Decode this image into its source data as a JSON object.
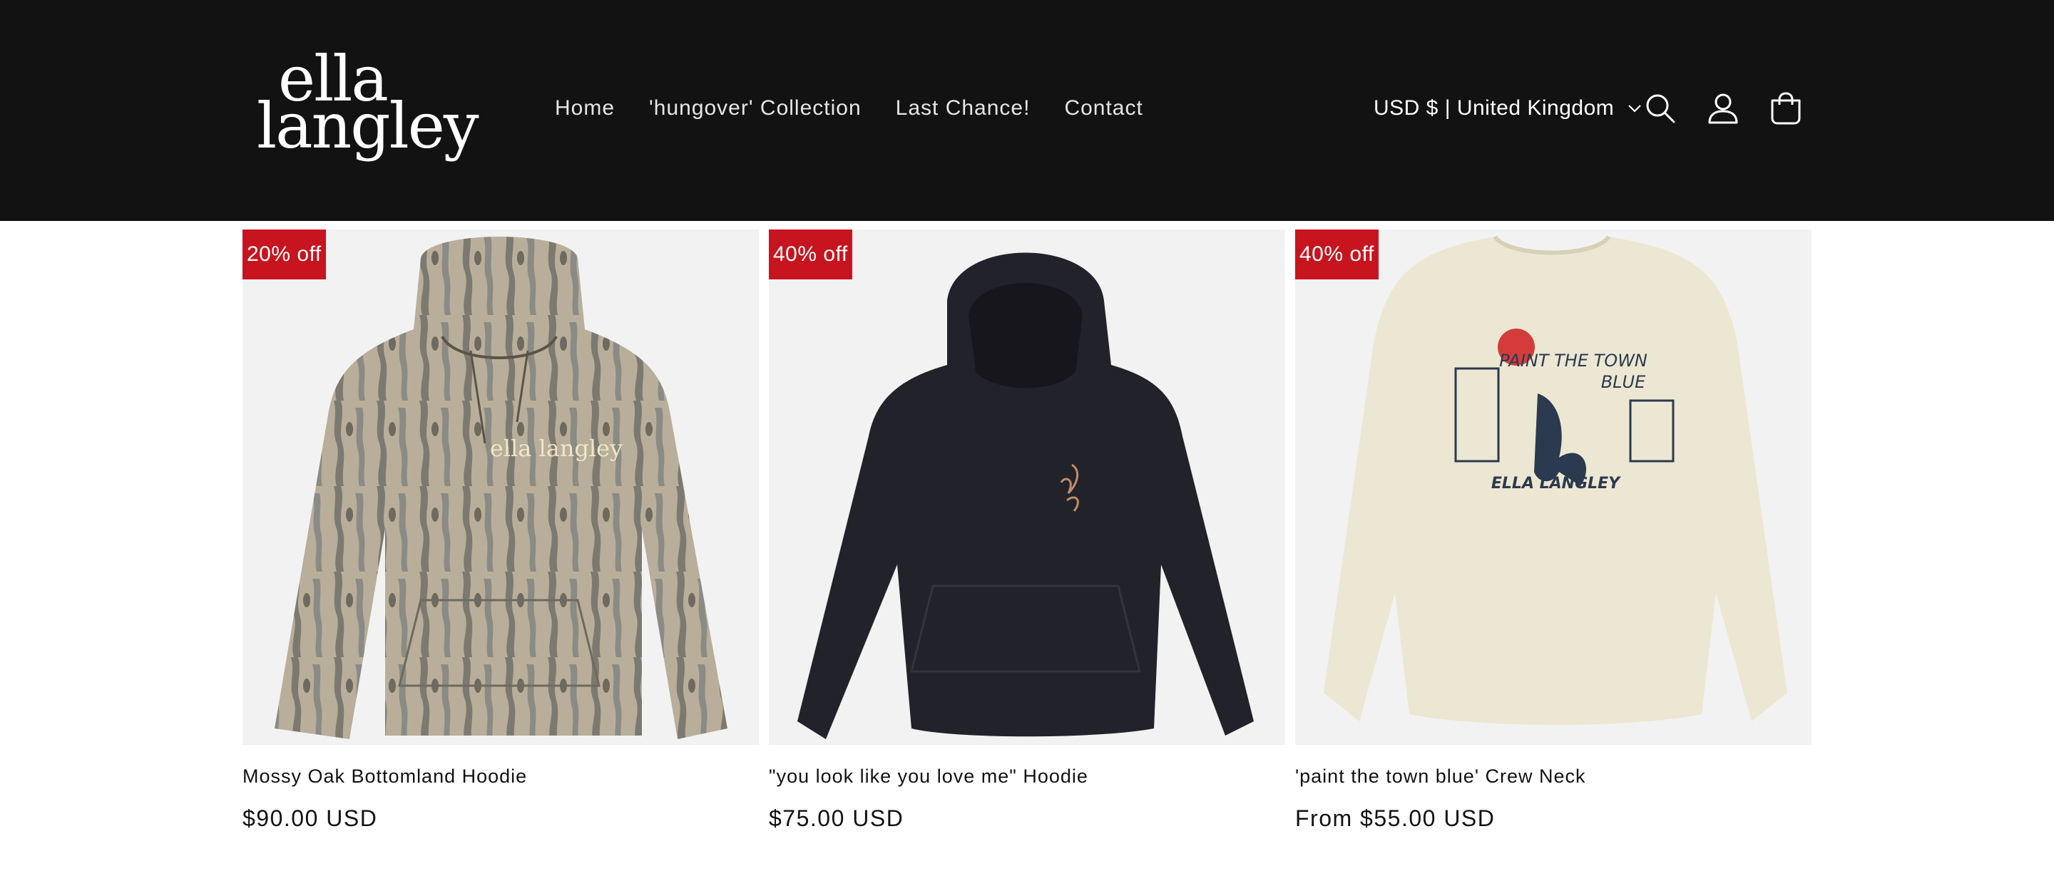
{
  "header": {
    "logo_line1": "ella",
    "logo_line2": "langley",
    "nav": [
      "Home",
      "'hungover' Collection",
      "Last Chance!",
      "Contact"
    ],
    "country_selector": "USD $ | United Kingdom",
    "icons": [
      "search-icon",
      "account-icon",
      "cart-icon"
    ]
  },
  "colors": {
    "header_bg": "#121212",
    "badge_bg": "#c8141e",
    "card_bg": "#f2f2f2"
  },
  "products": [
    {
      "badge": "20% off",
      "title": "Mossy Oak Bottomland Hoodie",
      "price": "$90.00 USD",
      "garment_print": "ella langley"
    },
    {
      "badge": "40% off",
      "title": "\"you look like you love me\" Hoodie",
      "price": "$75.00 USD"
    },
    {
      "badge": "40% off",
      "title": "'paint the town blue' Crew Neck",
      "price": "From $55.00 USD",
      "garment_print_top": "PAINT THE TOWN",
      "garment_print_mid": "BLUE",
      "garment_print_bottom": "ELLA LANGLEY"
    }
  ]
}
